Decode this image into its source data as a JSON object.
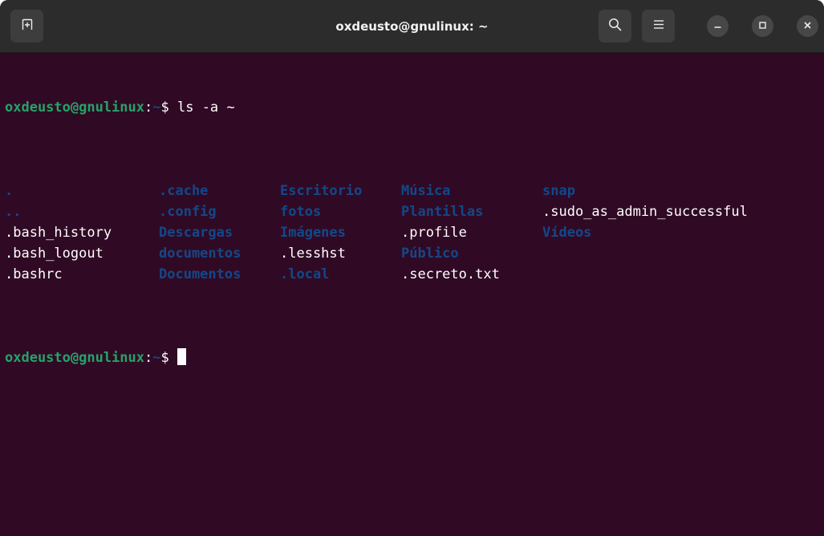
{
  "window": {
    "title": "oxdeusto@gnulinux: ~",
    "icons": {
      "new_tab": "new-tab-icon",
      "search": "search-icon",
      "menu": "hamburger-menu-icon",
      "minimize": "minimize-icon",
      "maximize": "maximize-icon",
      "close": "close-icon"
    }
  },
  "terminal": {
    "colors": {
      "background": "#300a24",
      "prompt_user": "#26a269",
      "directory": "#12488b",
      "text": "#ffffff"
    },
    "prompt": {
      "user_host": "oxdeusto@gnulinux",
      "colon": ":",
      "path": "~",
      "dollar": "$ "
    },
    "command": "ls -a ~",
    "listing": [
      [
        {
          "name": ".",
          "type": "dir"
        },
        {
          "name": ".cache",
          "type": "dir"
        },
        {
          "name": "Escritorio",
          "type": "dir"
        },
        {
          "name": "Música",
          "type": "dir"
        },
        {
          "name": "snap",
          "type": "dir"
        }
      ],
      [
        {
          "name": "..",
          "type": "dir"
        },
        {
          "name": ".config",
          "type": "dir"
        },
        {
          "name": "fotos",
          "type": "dir"
        },
        {
          "name": "Plantillas",
          "type": "dir"
        },
        {
          "name": ".sudo_as_admin_successful",
          "type": "file"
        }
      ],
      [
        {
          "name": ".bash_history",
          "type": "file"
        },
        {
          "name": "Descargas",
          "type": "dir"
        },
        {
          "name": "Imágenes",
          "type": "dir"
        },
        {
          "name": ".profile",
          "type": "file"
        },
        {
          "name": "Vídeos",
          "type": "dir"
        }
      ],
      [
        {
          "name": ".bash_logout",
          "type": "file"
        },
        {
          "name": "documentos",
          "type": "dir"
        },
        {
          "name": ".lesshst",
          "type": "file"
        },
        {
          "name": "Público",
          "type": "dir"
        },
        {
          "name": "",
          "type": "empty"
        }
      ],
      [
        {
          "name": ".bashrc",
          "type": "file"
        },
        {
          "name": "Documentos",
          "type": "dir"
        },
        {
          "name": ".local",
          "type": "dir"
        },
        {
          "name": ".secreto.txt",
          "type": "file"
        },
        {
          "name": "",
          "type": "empty"
        }
      ]
    ]
  }
}
